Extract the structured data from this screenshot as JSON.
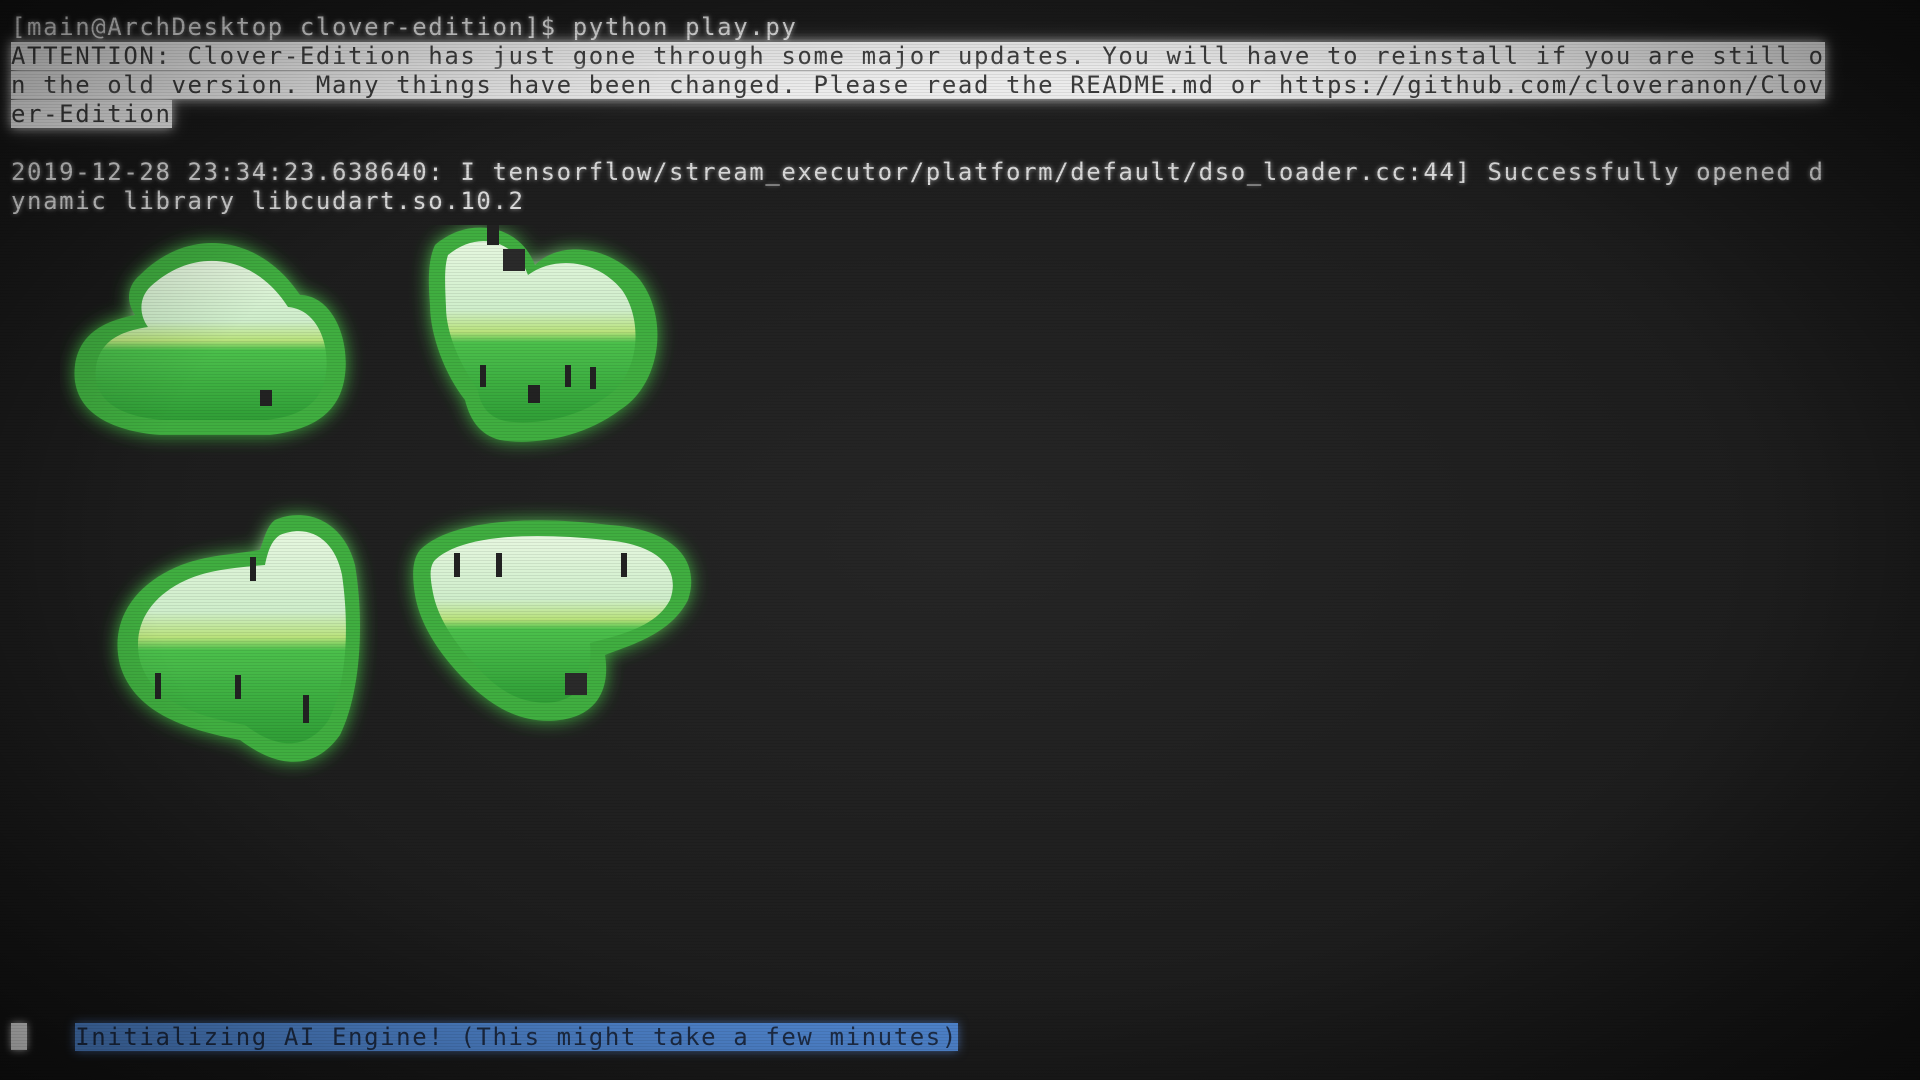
{
  "terminal": {
    "prompt_line": "[main@ArchDesktop clover-edition]$ python play.py",
    "attention_lines": [
      "ATTENTION: Clover-Edition has just gone through some major updates. You will have to reinstall if you are still o",
      "n the old version. Many things have been changed. Please read the README.md or https://github.com/cloveranon/Clov",
      "er-Edition"
    ],
    "log_lines": [
      "2019-12-28 23:34:23.638640: I tensorflow/stream_executor/platform/default/dso_loader.cc:44] Successfully opened d",
      "ynamic library libcudart.so.10.2"
    ],
    "status_message": "Initializing AI Engine! (This might take a few minutes)"
  },
  "colors": {
    "background": "#1f1f1f",
    "text": "#d9d9d9",
    "attention_highlight": "#ececec",
    "status_highlight": "#4f85cf",
    "clover_green": "#3fae3f",
    "clover_light": "#cfeecb"
  },
  "logo": {
    "icon": "four-leaf-clover-icon"
  }
}
